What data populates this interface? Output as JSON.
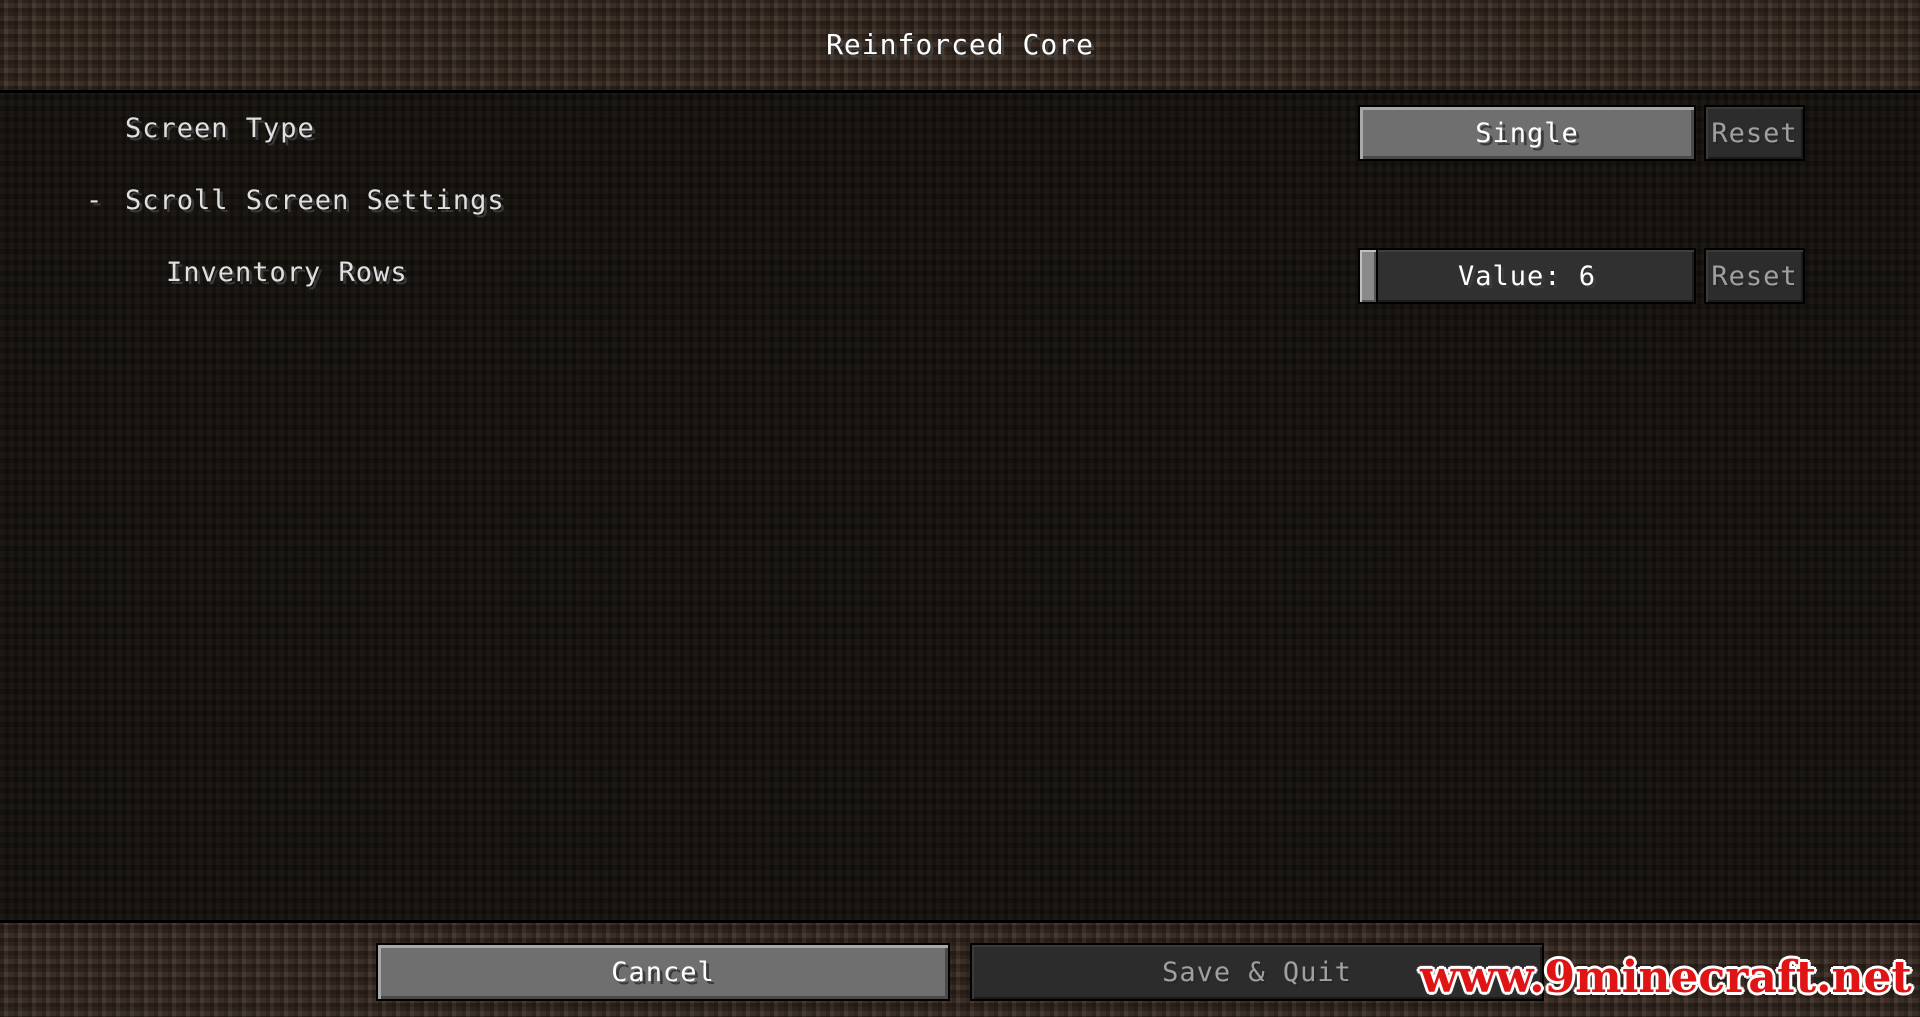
{
  "header": {
    "title": "Reinforced Core"
  },
  "entries": {
    "screen_type": {
      "label": "Screen Type",
      "value": "Single",
      "reset_label": "Reset"
    },
    "scroll_screen": {
      "collapse_symbol": "-",
      "label": "Scroll Screen Settings"
    },
    "inventory_rows": {
      "label": "Inventory Rows",
      "value_text": "Value: 6",
      "value": 6,
      "reset_label": "Reset"
    }
  },
  "footer": {
    "cancel_label": "Cancel",
    "save_label": "Save & Quit"
  },
  "watermark": {
    "text": "www.9minecraft.net"
  },
  "colors": {
    "watermark": "#e01414",
    "text": "#e0e0e0"
  }
}
